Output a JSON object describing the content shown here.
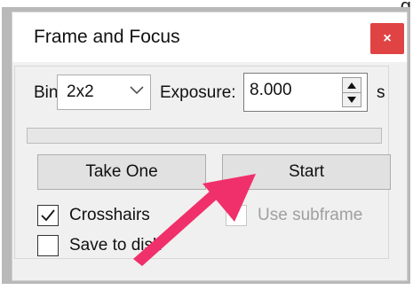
{
  "page_edge_glyph": "g",
  "window": {
    "title": "Frame and Focus",
    "close_label": "×"
  },
  "bin": {
    "label": "Bin",
    "value": "2x2"
  },
  "exposure": {
    "label": "Exposure:",
    "value": "8.000",
    "unit": "s"
  },
  "progress": {
    "fraction": 0
  },
  "buttons": {
    "take_one": "Take One",
    "start": "Start"
  },
  "checkboxes": {
    "crosshairs": {
      "label": "Crosshairs",
      "checked": true,
      "enabled": true
    },
    "use_subframe": {
      "label": "Use subframe",
      "checked": false,
      "enabled": false
    },
    "save_to_disk": {
      "label": "Save to disk",
      "checked": false,
      "enabled": true
    }
  },
  "annotation": {
    "arrow_color": "#f0306a"
  },
  "colors": {
    "close_button": "#e04343",
    "dialog_bg": "#f0f0f0"
  }
}
